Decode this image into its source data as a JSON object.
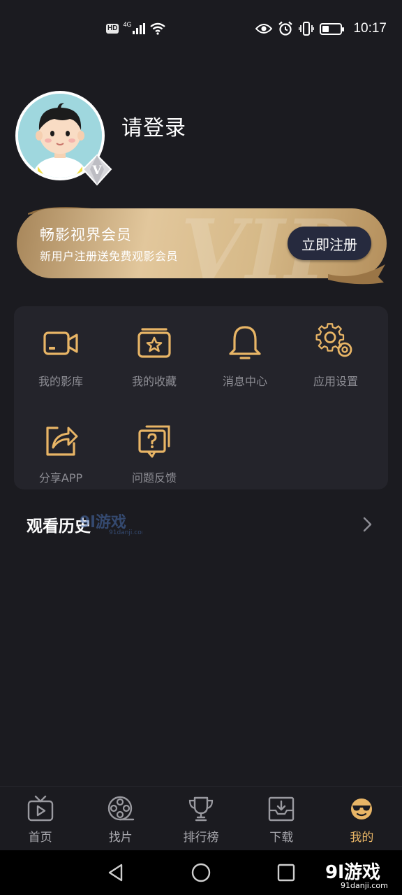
{
  "status_bar": {
    "hd_badge": "HD",
    "network": "4G",
    "time": "10:17",
    "battery_level": 0.3
  },
  "profile": {
    "login_label": "请登录",
    "vip_badge_letter": "V"
  },
  "vip_banner": {
    "title": "畅影视界会员",
    "subtitle": "新用户注册送免费观影会员",
    "watermark": "VIP",
    "register_button": "立即注册"
  },
  "menu": {
    "items": [
      {
        "label": "我的影库",
        "icon": "video-camera-icon"
      },
      {
        "label": "我的收藏",
        "icon": "star-folder-icon"
      },
      {
        "label": "消息中心",
        "icon": "bell-icon"
      },
      {
        "label": "应用设置",
        "icon": "gear-icon"
      },
      {
        "label": "分享APP",
        "icon": "share-icon"
      },
      {
        "label": "问题反馈",
        "icon": "question-chat-icon"
      }
    ]
  },
  "history": {
    "title": "观看历史"
  },
  "bottom_nav": {
    "items": [
      {
        "label": "首页",
        "icon": "tv-icon"
      },
      {
        "label": "找片",
        "icon": "film-reel-icon"
      },
      {
        "label": "排行榜",
        "icon": "trophy-icon"
      },
      {
        "label": "下载",
        "icon": "download-tray-icon"
      },
      {
        "label": "我的",
        "icon": "sunglasses-face-icon"
      }
    ],
    "active_index": 4
  },
  "watermark": {
    "brand": "9l游戏",
    "domain": "91danji.com"
  },
  "colors": {
    "background": "#1b1b20",
    "panel": "#24242b",
    "gold": "#e8b566",
    "vip_button": "#262a3e"
  }
}
